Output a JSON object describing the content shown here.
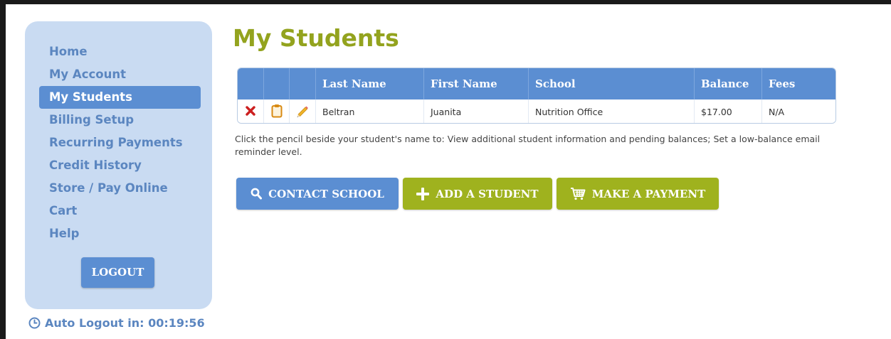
{
  "sidebar": {
    "items": [
      {
        "label": "Home",
        "active": false
      },
      {
        "label": "My Account",
        "active": false
      },
      {
        "label": "My Students",
        "active": true
      },
      {
        "label": "Billing Setup",
        "active": false
      },
      {
        "label": "Recurring Payments",
        "active": false
      },
      {
        "label": "Credit History",
        "active": false
      },
      {
        "label": "Store / Pay Online",
        "active": false
      },
      {
        "label": "Cart",
        "active": false
      },
      {
        "label": "Help",
        "active": false
      }
    ],
    "logout_label": "LOGOUT",
    "auto_logout_text": "Auto Logout in: 00:19:56"
  },
  "page": {
    "title": "My Students"
  },
  "grid": {
    "headers": [
      "",
      "",
      "",
      "Last Name",
      "First Name",
      "School",
      "Balance",
      "Fees"
    ],
    "rows": [
      {
        "row_icons": [
          "delete-icon",
          "clipboard-icon",
          "pencil-icon"
        ],
        "last_name": "Beltran",
        "first_name": "Juanita",
        "school": "Nutrition Office",
        "balance": "$17.00",
        "fees": "N/A"
      }
    ]
  },
  "help_text": "Click the pencil beside your student's name to: View additional student information and pending balances; Set a low-balance email reminder level.",
  "actions": {
    "contact_school": "CONTACT SCHOOL",
    "add_student": "ADD A STUDENT",
    "make_payment": "MAKE A PAYMENT"
  },
  "colors": {
    "accent_blue": "#5b8ed2",
    "accent_green": "#9fb21e",
    "title_green": "#93a31e",
    "sidebar_bg": "#c9dbf2",
    "nav_text": "#5b86c0",
    "delete_red": "#cc1f1f"
  }
}
